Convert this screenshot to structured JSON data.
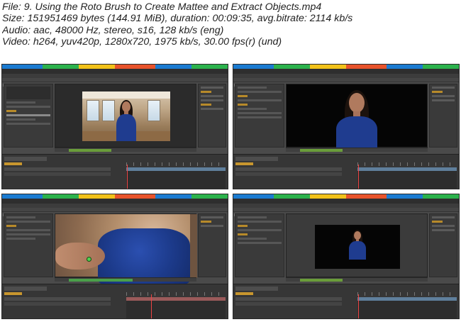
{
  "info": {
    "line1": "File: 9. Using the Roto Brush to Create Mattee and Extract Objects.mp4",
    "line2": "Size: 151951469 bytes (144.91 MiB), duration: 00:09:35, avg.bitrate: 2114 kb/s",
    "line3": "Audio: aac, 48000 Hz, stereo, s16, 128 kb/s (eng)",
    "line4": "Video: h264, yuv420p, 1280x720, 1975 kb/s, 30.00 fps(r) (und)"
  },
  "colors": {
    "accent_orange": "#c8962e",
    "woman_dress": "#1f3c8f",
    "ae_panel": "#3a3a3a"
  }
}
